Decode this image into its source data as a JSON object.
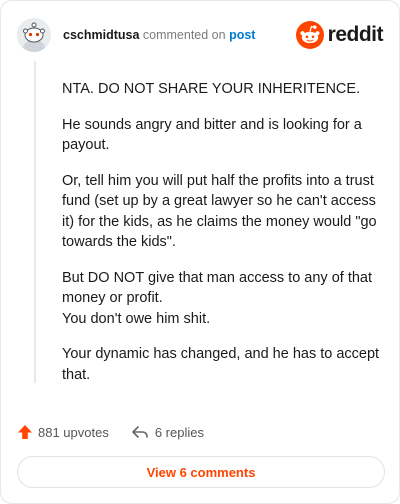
{
  "header": {
    "username": "cschmidtusa",
    "action_text": "commented on",
    "post_link": "post",
    "brand": "reddit",
    "brand_color": "#ff4500"
  },
  "comment": {
    "paragraphs": [
      "NTA. DO NOT SHARE YOUR INHERITENCE.",
      "He sounds angry and bitter and is looking for a payout.",
      "Or, tell him you will put half the profits into a trust fund (set up by a great lawyer so he can't access it) for the kids, as he claims the money would \"go towards the kids\".",
      "But DO NOT give that man access to any of that money or profit.",
      "Your dynamic has changed, and he has to accept that."
    ],
    "line_after_p4": "You don't owe him shit."
  },
  "footer": {
    "upvotes": "881 upvotes",
    "replies": "6 replies",
    "upvote_icon": "upvote-arrow-icon",
    "reply_icon": "reply-arrow-icon"
  },
  "actions": {
    "view_comments": "View 6 comments"
  }
}
